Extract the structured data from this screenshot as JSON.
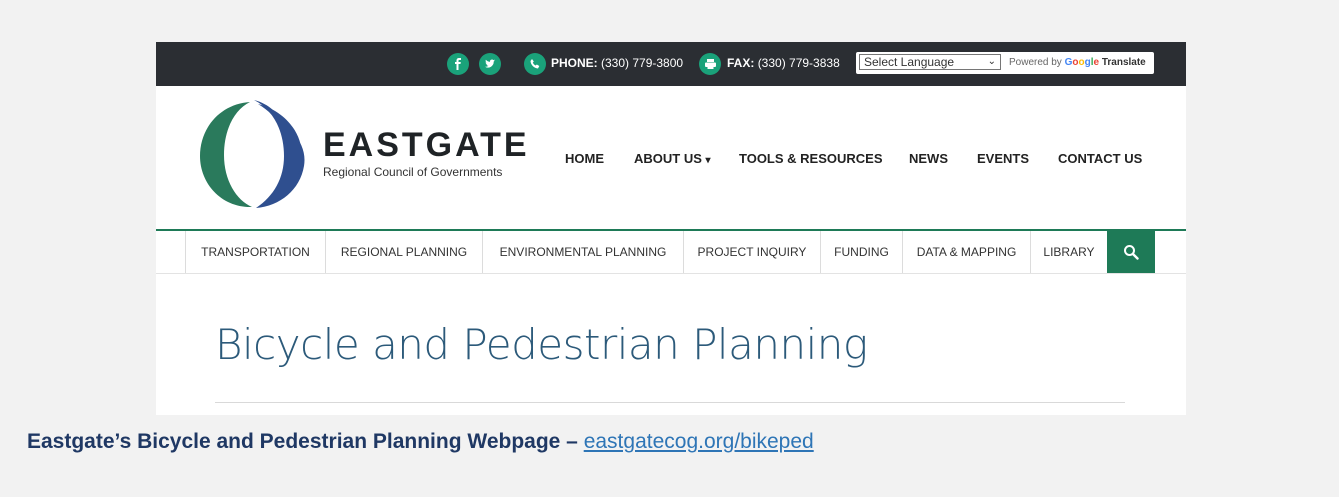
{
  "topbar": {
    "social": [
      "facebook-icon",
      "twitter-icon"
    ],
    "phone_label": "PHONE:",
    "phone_value": "(330) 779-3800",
    "fax_label": "FAX:",
    "fax_value": "(330) 779-3838",
    "language_select": "Select Language",
    "powered_by": "Powered by",
    "google_letters": [
      "G",
      "o",
      "o",
      "g",
      "l",
      "e"
    ],
    "translate": "Translate"
  },
  "logo": {
    "name": "EASTGATE",
    "subtitle": "Regional Council of Governments"
  },
  "main_nav": [
    "HOME",
    "ABOUT US",
    "TOOLS & RESOURCES",
    "NEWS",
    "EVENTS",
    "CONTACT US"
  ],
  "about_caret": "▾",
  "sub_nav": [
    "TRANSPORTATION",
    "REGIONAL PLANNING",
    "ENVIRONMENTAL PLANNING",
    "PROJECT INQUIRY",
    "FUNDING",
    "DATA & MAPPING",
    "LIBRARY"
  ],
  "page_title": "Bicycle and Pedestrian Planning",
  "caption": {
    "text": "Eastgate’s Bicycle and Pedestrian Planning Webpage –",
    "link": "eastgatecog.org/bikeped"
  },
  "colors": {
    "topbar": "#2b2e33",
    "accent_green": "#1e7a57",
    "icon_teal": "#1aa27a",
    "title_blue": "#2c5a7a",
    "caption_navy": "#1f3864",
    "link_blue": "#2e75b6"
  }
}
